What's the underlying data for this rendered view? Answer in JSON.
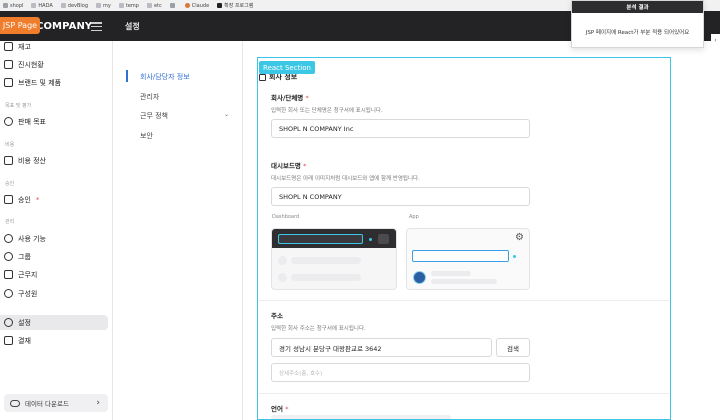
{
  "bookmarks": [
    "shopl",
    "HADA",
    "devBlog",
    "my",
    "temp",
    "etc",
    "",
    "Claude",
    "확장 프로그램"
  ],
  "header": {
    "brand": "COMPANY",
    "title": "설정",
    "jsp_tag": "JSP Page"
  },
  "popup": {
    "title": "분석 결과",
    "message": "JSP 페이지에 React가 부분 적용 되어있어요"
  },
  "sidebar": {
    "items": [
      {
        "label": "재고"
      },
      {
        "label": "진시현황"
      },
      {
        "label": "브랜드 및 제품"
      },
      {
        "section": "목표 및 평가"
      },
      {
        "label": "판매 목표"
      },
      {
        "section": "비용"
      },
      {
        "label": "비용 정산"
      },
      {
        "section": "승인"
      },
      {
        "label": "승인",
        "required": "*"
      },
      {
        "section": "관리"
      },
      {
        "label": "사용 기능"
      },
      {
        "label": "그룹"
      },
      {
        "label": "근무지"
      },
      {
        "label": "구성원"
      },
      {
        "label": "설정"
      },
      {
        "label": "결재"
      }
    ],
    "download_label": "데이터 다운로드"
  },
  "subnav": {
    "items": [
      "회사/담당자 정보",
      "관리자",
      "근무 정책",
      "보안"
    ]
  },
  "main": {
    "react_tag": "React Section",
    "section_title": "회사 정보",
    "company_name": {
      "label": "회사/단체명",
      "required": "*",
      "desc": "입력한 회사 또는 단체명은 청구서에 표시됩니다.",
      "value": "SHOPL N COMPANY Inc"
    },
    "display_name": {
      "label": "대시보드명",
      "required": "*",
      "desc": "대시보드명은 아래 이미지처럼 대시보드와 앱에 함께 반영됩니다.",
      "value": "SHOPL N COMPANY"
    },
    "preview": {
      "dashboard_label": "Dashboard",
      "app_label": "App"
    },
    "address": {
      "label": "주소",
      "desc": "입력한 회사 주소는 청구서에 표시됩니다.",
      "value": "경기 성남시 분당구 대왕판교로 3642",
      "search_button": "검색",
      "detail_placeholder": "상세주소(층, 호수)"
    },
    "language": {
      "label": "언어",
      "required": "*"
    }
  },
  "colors": {
    "accent": "#3cc7e6",
    "jsp": "#f07d2b",
    "header": "#232325",
    "link": "#2f6fd6"
  }
}
